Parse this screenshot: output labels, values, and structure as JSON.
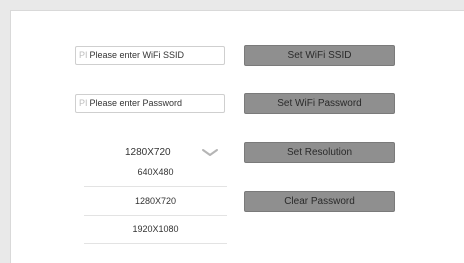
{
  "wifi": {
    "ssid_prefix": "PI",
    "ssid_placeholder": "Please enter WiFi SSID",
    "set_ssid_label": "Set WiFi SSID",
    "password_prefix": "PI",
    "password_placeholder": "Please enter Password",
    "set_password_label": "Set WiFi Password"
  },
  "resolution": {
    "selected": "1280X720",
    "options": [
      "640X480",
      "1280X720",
      "1920X1080"
    ],
    "set_label": "Set Resolution"
  },
  "clear_password_label": "Clear Password",
  "icons": {
    "dropdown": "chevron-down-icon"
  },
  "colors": {
    "button_bg": "#8f8f8f",
    "background": "#e9e9e9"
  }
}
